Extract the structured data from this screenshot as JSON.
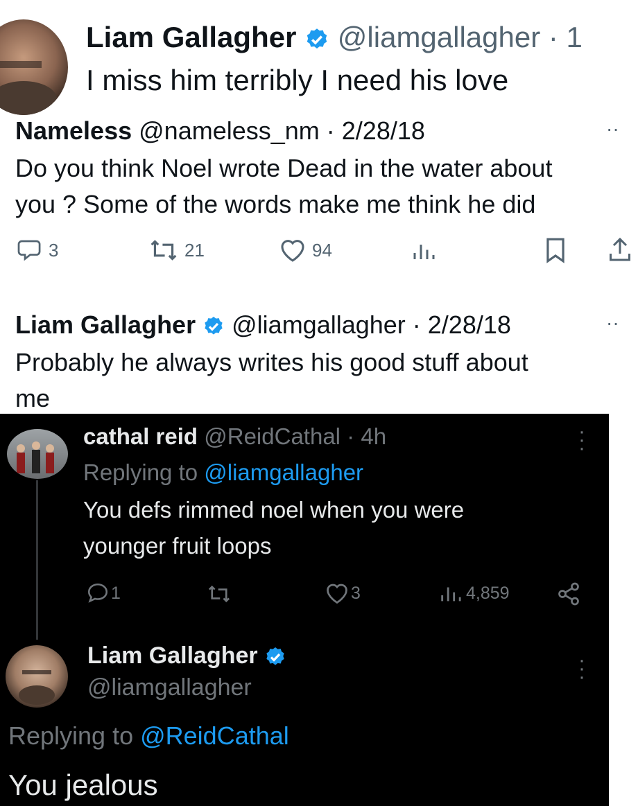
{
  "top_tweet": {
    "name": "Liam Gallagher",
    "handle": "@liamgallagher · 1",
    "text": "I miss him terribly I need his love"
  },
  "nameless_tweet": {
    "name": "Nameless",
    "handle": "@nameless_nm · 2/28/18",
    "line1": "Do you think Noel wrote Dead in the water about",
    "line2": "you ? Some of the words make me think he did",
    "replies": "3",
    "retweets": "21",
    "likes": "94"
  },
  "liam_reply": {
    "name": "Liam Gallagher",
    "handle": "@liamgallagher · 2/28/18",
    "line1": "Probably he always writes his good stuff about",
    "line2": "me"
  },
  "cathal_tweet": {
    "name": "cathal reid",
    "handle": "@ReidCathal · 4h",
    "replying_prefix": "Replying to ",
    "replying_handle": "@liamgallagher",
    "line1": "You defs rimmed noel when you were",
    "line2": "younger fruit loops",
    "replies": "1",
    "likes": "3",
    "views": "4,859"
  },
  "liam_final": {
    "name": "Liam Gallagher",
    "handle": "@liamgallagher",
    "replying_prefix": "Replying to ",
    "replying_handle": "@ReidCathal",
    "text": "You jealous"
  },
  "colors": {
    "verified": "#1d9bf0",
    "link": "#1d9bf0",
    "dark_bg": "#000000"
  }
}
